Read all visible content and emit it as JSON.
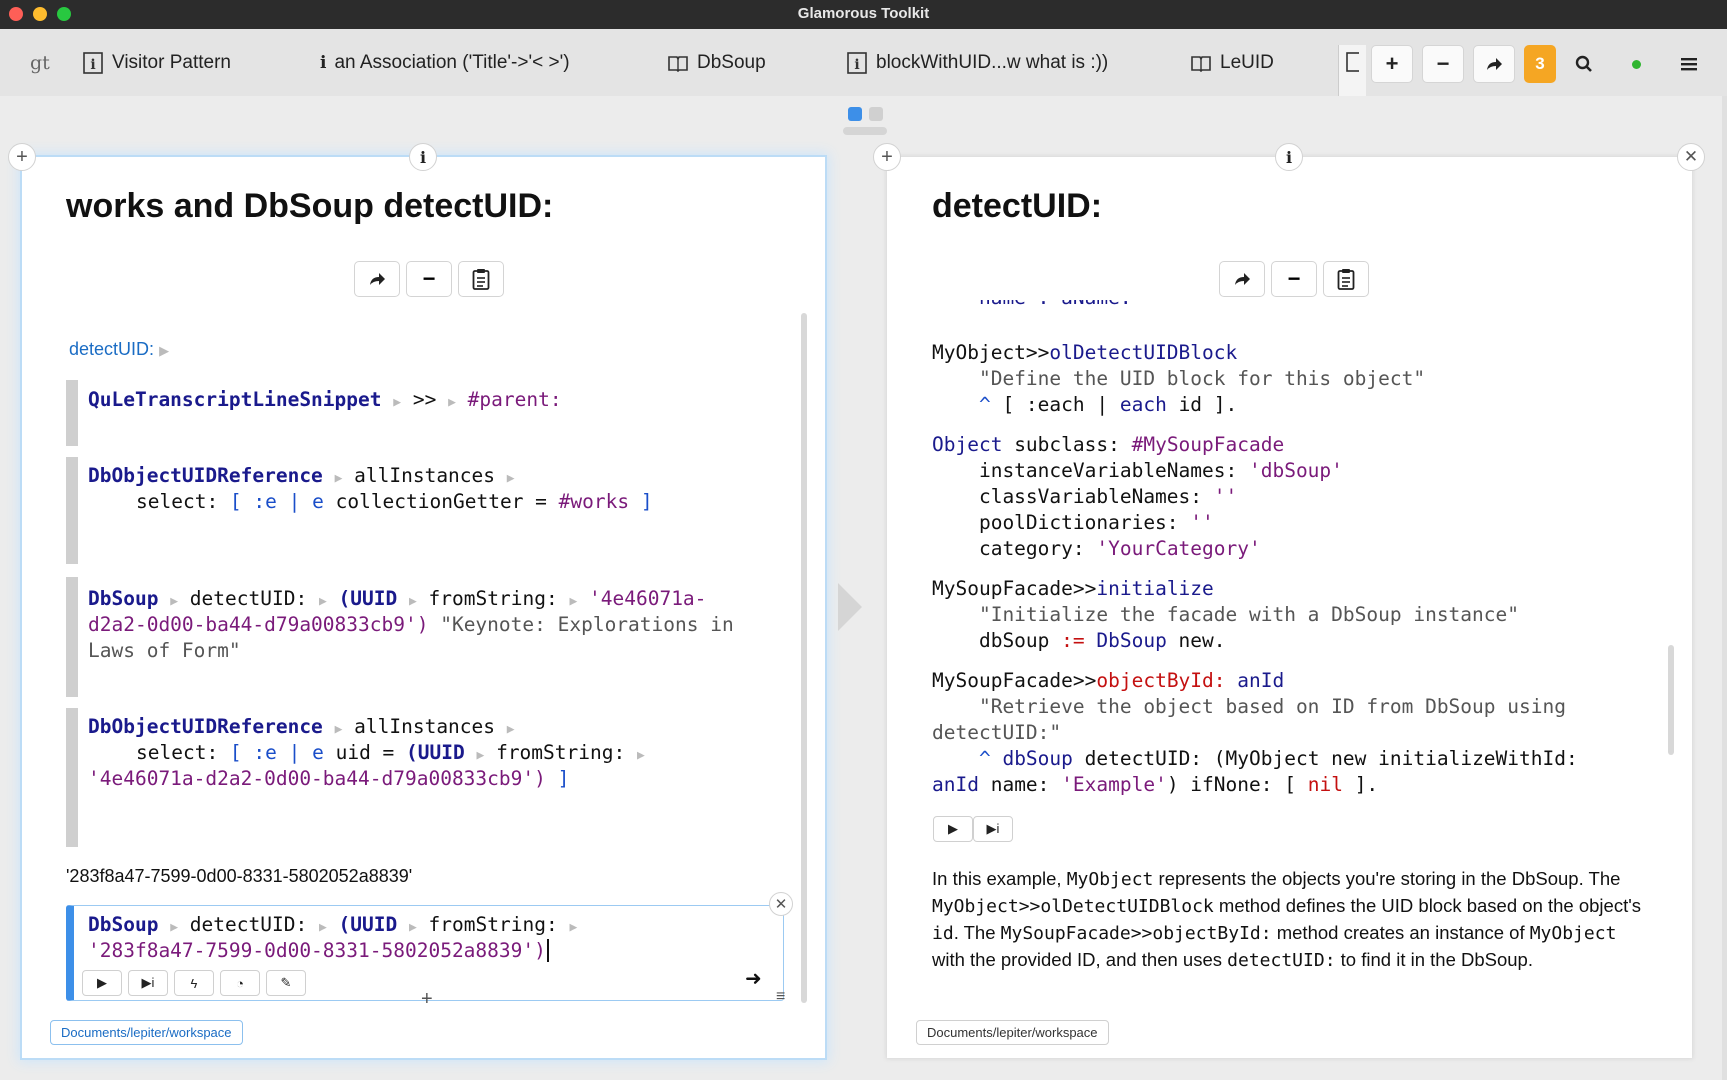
{
  "window": {
    "title": "Glamorous Toolkit"
  },
  "tabs": [
    {
      "label": "gt"
    },
    {
      "label": "Visitor Pattern"
    },
    {
      "label": "an Association ('Title'->'< >')"
    },
    {
      "label": "DbSoup"
    },
    {
      "label": "blockWithUID...w what is :))"
    },
    {
      "label": "LeUID"
    }
  ],
  "toolbar": {
    "notification_count": "3"
  },
  "left_pane": {
    "title": "works and DbSoup detectUID:",
    "breadcrumb": "detectUID:",
    "result_text": "'283f8a47-7599-0d00-8331-5802052a8839'",
    "path": "Documents/lepiter/workspace"
  },
  "right_pane": {
    "title": "detectUID:",
    "path": "Documents/lepiter/workspace"
  },
  "code": {
    "l_s1": {
      "a": "QuLeTranscriptLineSnippet",
      "b": ">>",
      "c": "#parent:"
    },
    "l_s2": {
      "a": "DbObjectUIDReference",
      "b": "allInstances",
      "c": "select: ",
      "d": "[ :e | e ",
      "e": "collectionGetter = ",
      "f": "#works",
      "g": " ]"
    },
    "l_s3": {
      "a": "DbSoup",
      "b": "detectUID:",
      "c": "(UUID",
      "d": "fromString:",
      "e": "'4e46071a-",
      "f": "d2a2-0d00-ba44-d79a00833cb9')",
      "g": " \"Keynote: Explorations in",
      "h": "Laws of Form\""
    },
    "l_s4": {
      "a": "DbObjectUIDReference",
      "b": "allInstances",
      "c": "select: ",
      "d": "[ :e | e ",
      "e": "uid = ",
      "f": "(UUID",
      "g": "fromString:",
      "h": "'4e46071a-d2a2-0d00-ba44-d79a00833cb9')",
      "i": " ]"
    },
    "l_s5": {
      "a": "DbSoup",
      "b": "detectUID:",
      "c": "(UUID",
      "d": "fromString:",
      "e": "'283f8a47-7599-0d00-8331-5802052a8839'",
      "f": ")"
    },
    "r": {
      "l0": "    name : aName.",
      "l1a": "MyObject>>",
      "l1b": "olDetectUIDBlock",
      "l2": "    \"Define the UID block for this object\"",
      "l3a": "    ^ ",
      "l3b": "[ :each | ",
      "l3c": "each",
      "l3d": " id ].",
      "l4a": "Object",
      "l4b": " subclass: ",
      "l4c": "#MySoupFacade",
      "l5a": "    instanceVariableNames: ",
      "l5b": "'dbSoup'",
      "l6a": "    classVariableNames: ",
      "l6b": "''",
      "l7a": "    poolDictionaries: ",
      "l7b": "''",
      "l8a": "    category: ",
      "l8b": "'YourCategory'",
      "l9a": "MySoupFacade>>",
      "l9b": "initialize",
      "l10": "    \"Initialize the facade with a DbSoup instance\"",
      "l11a": "    dbSoup ",
      "l11b": ":=",
      "l11c": " DbSoup",
      "l11d": " new.",
      "l12a": "MySoupFacade>>",
      "l12b": "objectById:",
      "l12c": " anId",
      "l13": "    \"Retrieve the object based on ID from DbSoup using",
      "l14": "detectUID:\"",
      "l15a": "    ^ ",
      "l15b": "dbSoup",
      "l15c": " detectUID: (MyObject new initializeWithId:",
      "l16a": "anId",
      "l16b": " name: ",
      "l16c": "'Example'",
      "l16d": ") ifNone: [ ",
      "l16e": "nil",
      "l16f": " ]."
    }
  },
  "prose": {
    "p1": "In this example, ",
    "p2": "MyObject",
    "p3": " represents the objects you're storing in the DbSoup. The ",
    "p4": "MyObject>>olDetectUIDBlock",
    "p5": " method defines the UID block based on the object's ",
    "p6": "id",
    "p7": ". The ",
    "p8": "MySoupFacade>>objectById:",
    "p9": " method creates an instance of ",
    "p10": "MyObject",
    "p11": " with the provided ID, and then uses ",
    "p12": "detectUID:",
    "p13": " to find it in the DbSoup."
  },
  "colors": {
    "accent": "#1a6cc4",
    "badge": "#f5a623",
    "status": "#2fb52f"
  }
}
